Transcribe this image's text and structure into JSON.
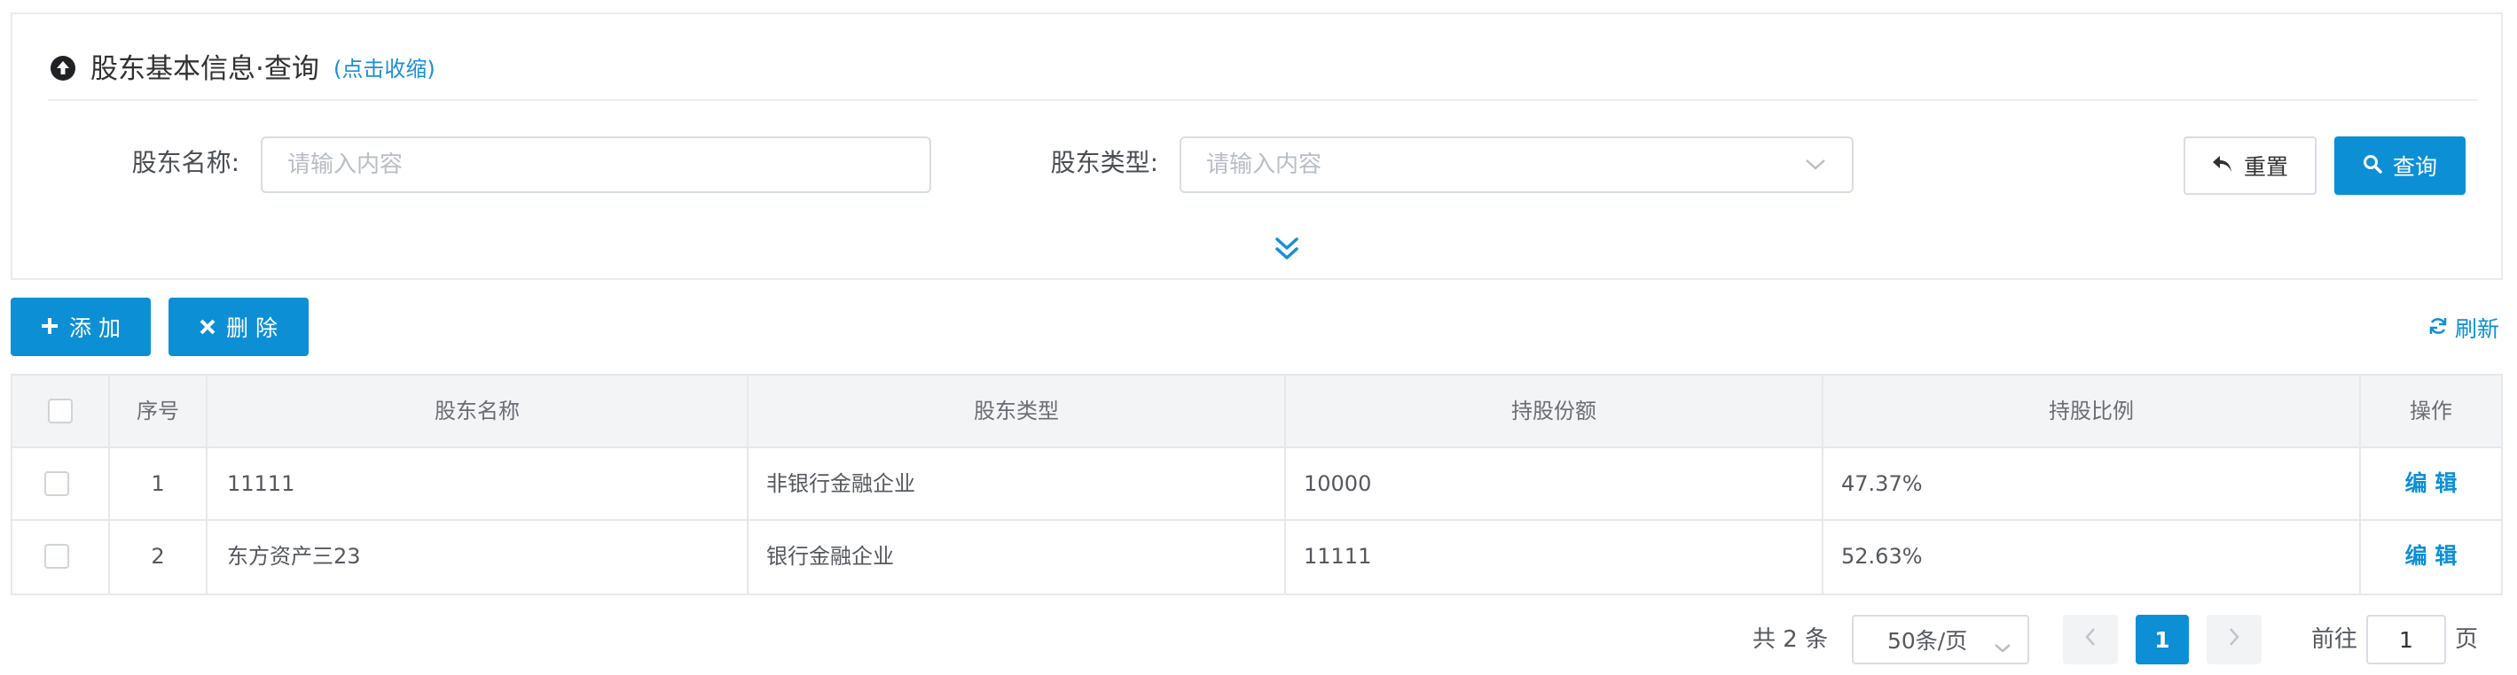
{
  "query_panel": {
    "title": "股东基本信息·查询",
    "collapse_label": "(点击收缩)",
    "fields": [
      {
        "label": "股东名称:",
        "placeholder": "请输入内容"
      },
      {
        "label": "股东类型:",
        "placeholder": "请输入内容"
      }
    ],
    "reset_label": "重置",
    "search_label": "查询"
  },
  "toolbar": {
    "add_label": "添 加",
    "delete_label": "删 除",
    "refresh_label": "刷新"
  },
  "table": {
    "headers": [
      "序号",
      "股东名称",
      "股东类型",
      "持股份额",
      "持股比例",
      "操作"
    ],
    "rows": [
      {
        "index": "1",
        "name": "11111",
        "type": "非银行金融企业",
        "shares": "10000",
        "ratio": "47.37%",
        "action": "编 辑"
      },
      {
        "index": "2",
        "name": "东方资产三23",
        "type": "银行金融企业",
        "shares": "11111",
        "ratio": "52.63%",
        "action": "编 辑"
      }
    ]
  },
  "pagination": {
    "total_label": "共 2 条",
    "page_size_label": "50条/页",
    "current_page": "1",
    "goto_prefix": "前往",
    "goto_value": "1",
    "goto_suffix": "页"
  },
  "colors": {
    "primary": "#0d8fd6",
    "border": "#d8dce4",
    "header_bg": "#f3f4f6"
  }
}
